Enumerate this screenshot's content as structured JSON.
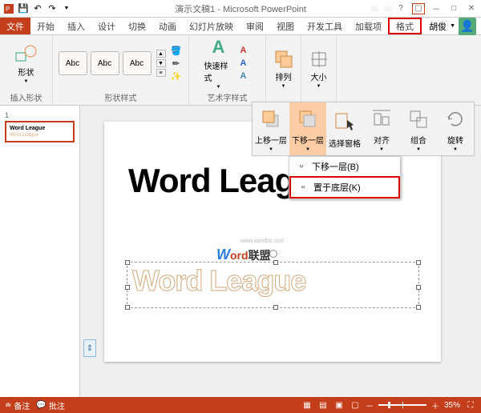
{
  "titlebar": {
    "title": "演示文稿1 - Microsoft PowerPoint"
  },
  "user": {
    "name": "胡俊"
  },
  "tabs": {
    "file": "文件",
    "items": [
      "开始",
      "插入",
      "设计",
      "切换",
      "动画",
      "幻灯片放映",
      "审阅",
      "视图",
      "开发工具",
      "加载项"
    ],
    "format": "格式"
  },
  "ribbon": {
    "insert_shape_label": "形状",
    "insert_shape_group": "插入形状",
    "shape_style_item": "Abc",
    "shape_style_group": "形状样式",
    "quick_style_label": "快速样式",
    "wordart_group": "艺术字样式",
    "arrange_label": "排列",
    "size_label": "大小"
  },
  "popup": {
    "bring_forward": "上移一层",
    "send_backward": "下移一层",
    "selection_pane": "选择窗格",
    "align": "对齐",
    "group": "组合",
    "rotate": "旋转"
  },
  "dropdown": {
    "send_backward": "下移一层(B)",
    "send_to_back": "置于底层(K)"
  },
  "thumb": {
    "num": "1",
    "t1": "Word League",
    "t2": "Word League"
  },
  "slide": {
    "headline": "Word League",
    "outline": "Word League",
    "logo_ord": "ord",
    "logo_lm": "联盟",
    "logo_url": "www.wordlm.com"
  },
  "status": {
    "notes": "备注",
    "comments": "批注",
    "zoom_minus": "－",
    "zoom_plus": "＋",
    "zoom_val": "35%"
  }
}
